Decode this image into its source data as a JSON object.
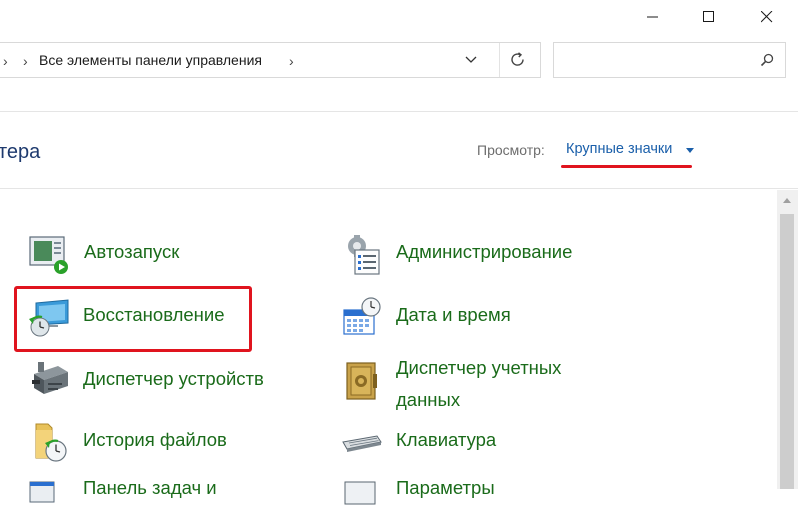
{
  "window": {
    "minimize_icon": "minimize-icon",
    "maximize_icon": "maximize-icon",
    "close_icon": "close-icon"
  },
  "address_bar": {
    "breadcrumb": "Все элементы панели управления",
    "refresh_icon": "refresh-icon",
    "dropdown_icon": "chevron-down-icon"
  },
  "search": {
    "value": "",
    "placeholder": "",
    "icon": "search-icon"
  },
  "header": {
    "title_partial": "тера",
    "view_label": "Просмотр:",
    "view_value": "Крупные значки"
  },
  "items": [
    {
      "label": "Автозапуск",
      "icon": "autoplay-icon"
    },
    {
      "label": "Администрирование",
      "icon": "administrative-tools-icon"
    },
    {
      "label": "Восстановление",
      "icon": "recovery-icon"
    },
    {
      "label": "Дата и время",
      "icon": "date-time-icon"
    },
    {
      "label": "Диспетчер устройств",
      "icon": "device-manager-icon"
    },
    {
      "label": "Диспетчер учетных данных",
      "icon": "credential-manager-icon"
    },
    {
      "label": "История файлов",
      "icon": "file-history-icon"
    },
    {
      "label": "Клавиатура",
      "icon": "keyboard-icon"
    },
    {
      "label": "Панель задач и",
      "icon": "taskbar-icon"
    },
    {
      "label": "Параметры",
      "icon": "options-icon"
    }
  ],
  "colors": {
    "link_green": "#1a6b1a",
    "view_blue": "#1a5faa",
    "highlight_red": "#e0141e"
  }
}
